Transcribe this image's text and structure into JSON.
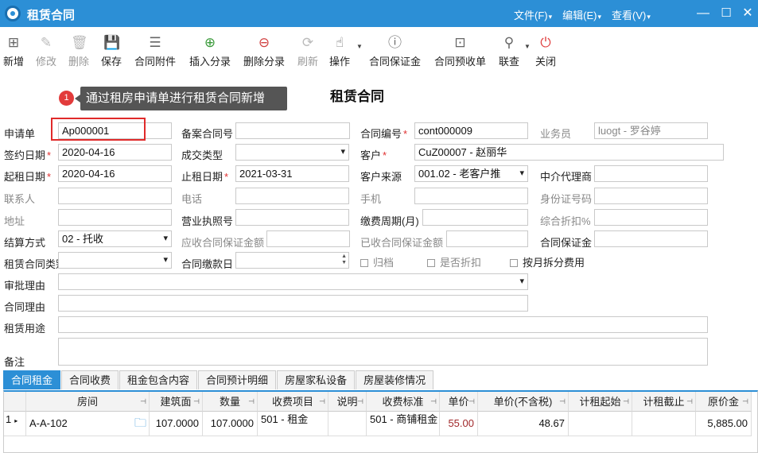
{
  "window": {
    "title": "租赁合同",
    "menus": [
      "文件(F)",
      "编辑(E)",
      "查看(V)"
    ]
  },
  "toolbar": {
    "new": "新增",
    "edit": "修改",
    "delete": "删除",
    "save": "保存",
    "attachment": "合同附件",
    "insert_split": "插入分录",
    "delete_split": "删除分录",
    "refresh": "刷新",
    "operate": "操作",
    "deposit": "合同保证金",
    "prereceipt": "合同预收单",
    "link_query": "联查",
    "close": "关闭"
  },
  "form": {
    "title": "租赁合同",
    "tooltip": "通过租房申请单进行租赁合同新增",
    "badge": "1",
    "application_label": "申请单",
    "application_value": "Ap000001",
    "record_no_label": "备案合同号",
    "record_no_value": "",
    "contract_no_label": "合同编号",
    "contract_no_value": "cont000009",
    "salesman_label": "业务员",
    "salesman_value": "luogt  - 罗谷婷",
    "sign_date_label": "签约日期",
    "sign_date_value": "2020-04-16",
    "deal_type_label": "成交类型",
    "deal_type_value": "",
    "customer_label": "客户",
    "customer_value": "CuZ00007 - 赵丽华",
    "start_date_label": "起租日期",
    "start_date_value": "2020-04-16",
    "end_date_label": "止租日期",
    "end_date_value": "2021-03-31",
    "source_label": "客户来源",
    "source_value": "001.02 - 老客户推",
    "agent_label": "中介代理商",
    "agent_value": "",
    "contact_label": "联系人",
    "contact_value": "",
    "phone_label": "电话",
    "phone_value": "",
    "mobile_label": "手机",
    "mobile_value": "",
    "idcard_label": "身份证号码",
    "idcard_value": "",
    "address_label": "地址",
    "address_value": "",
    "license_label": "营业执照号",
    "license_value": "",
    "pay_period_label": "缴费周期(月)",
    "pay_period_value": "",
    "discount_label": "综合折扣%",
    "discount_value": "",
    "settle_label": "结算方式",
    "settle_value": "02 - 托收",
    "due_deposit_label": "应收合同保证金额",
    "due_deposit_value": "",
    "received_deposit_label": "已收合同保证金额",
    "received_deposit_value": "",
    "deposit_label": "合同保证金",
    "deposit_value": "",
    "contract_type_label": "租赁合同类别",
    "contract_type_value": "",
    "pay_day_label": "合同缴款日",
    "pay_day_value": "",
    "archive_label": "归档",
    "discounted_label": "是否折扣",
    "monthly_split_label": "按月拆分费用",
    "approval_label": "审批理由",
    "approval_value": "",
    "reason_label": "合同理由",
    "reason_value": "",
    "purpose_label": "租赁用途",
    "purpose_value": "",
    "remark_label": "备注",
    "remark_value": ""
  },
  "tabs": [
    "合同租金",
    "合同收费",
    "租金包含内容",
    "合同预计明细",
    "房屋家私设备",
    "房屋装修情况"
  ],
  "grid": {
    "columns": [
      "房间",
      "建筑面",
      "数量",
      "收费项目",
      "说明",
      "收费标准",
      "单价",
      "单价(不含税)",
      "计租起始",
      "计租截止",
      "原价金"
    ],
    "rows": [
      {
        "index": "1",
        "room": "A-A-102",
        "area": "107.0000",
        "qty": "107.0000",
        "item": "501 - 租金",
        "note": "",
        "standard": "501 - 商铺租金",
        "price": "55.00",
        "price_ex_tax": "48.67",
        "start": "",
        "end": "",
        "amount": "5,885.00"
      }
    ]
  }
}
